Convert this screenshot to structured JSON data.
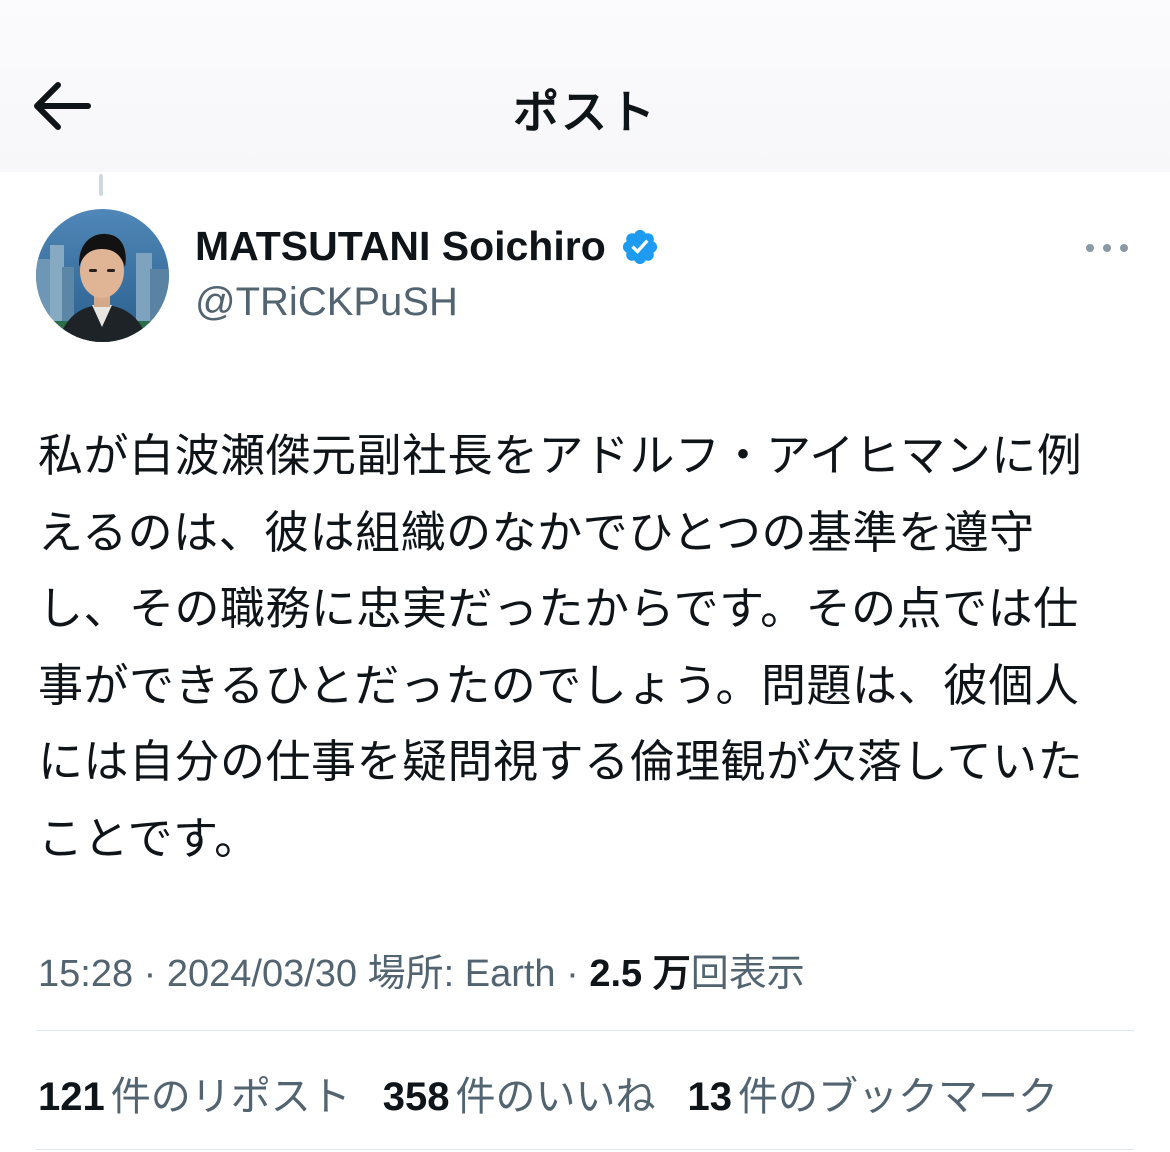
{
  "header": {
    "title": "ポスト",
    "back_icon": "arrow-left-icon"
  },
  "author": {
    "name": "MATSUTANI Soichiro",
    "handle": "@TRiCKPuSH",
    "verified_color": "#1d9bf0",
    "avatar": "profile-photo"
  },
  "post": {
    "lines": [
      "私が白波瀬傑元副社長をアドルフ・アイヒマンに例",
      "えるのは、彼は組織のなかでひとつの基準を遵守",
      "し、その職務に忠実だったからです。その点では仕",
      "事ができるひとだったのでしょう。問題は、彼個人",
      "には自分の仕事を疑問視する倫理観が欠落していた",
      "ことです。"
    ]
  },
  "meta": {
    "time": "15:28",
    "date": "2024/03/30",
    "location": "場所: Earth",
    "separator": "·",
    "views_count": "2.5 万",
    "views_label": "回表示"
  },
  "stats": {
    "reposts_count": "121",
    "reposts_label": "件のリポスト",
    "likes_count": "358",
    "likes_label": "件のいいね",
    "bookmarks_count": "13",
    "bookmarks_label": "件のブックマーク"
  }
}
